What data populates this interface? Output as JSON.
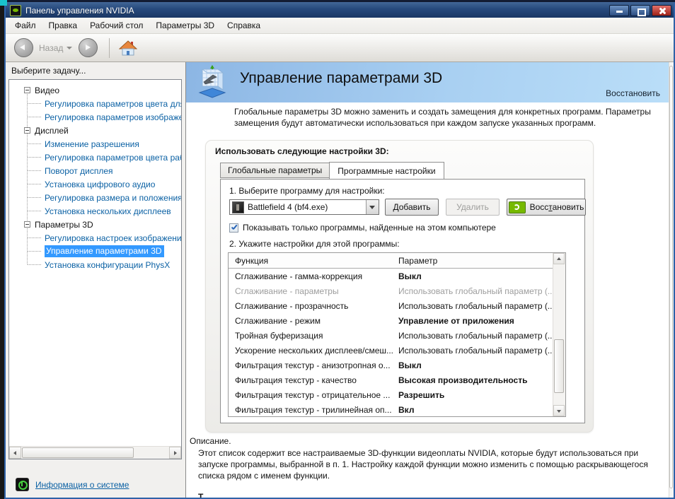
{
  "window": {
    "title": "Панель управления NVIDIA"
  },
  "menu": {
    "items": [
      "Файл",
      "Правка",
      "Рабочий стол",
      "Параметры 3D",
      "Справка"
    ]
  },
  "toolbar": {
    "back_label": "Назад"
  },
  "sidebar": {
    "header": "Выберите задачу...",
    "selected": "Управление параметрами 3D",
    "sections": [
      {
        "label": "Видео",
        "children": [
          "Регулировка параметров цвета для ви",
          "Регулировка параметров изображени"
        ]
      },
      {
        "label": "Дисплей",
        "children": [
          "Изменение разрешения",
          "Регулировка параметров цвета рабоч",
          "Поворот дисплея",
          "Установка цифрового аудио",
          "Регулировка размера и положения ра",
          "Установка нескольких дисплеев"
        ]
      },
      {
        "label": "Параметры 3D",
        "children": [
          "Регулировка настроек изображения с",
          "Управление параметрами 3D",
          "Установка конфигурации PhysX"
        ]
      }
    ],
    "footer_link": "Информация о системе"
  },
  "content": {
    "title": "Управление параметрами 3D",
    "restore_link": "Восстановить",
    "intro": "Глобальные параметры 3D можно заменить и создать замещения для конкретных программ. Параметры замещения будут автоматически использоваться при каждом запуске указанных программ.",
    "panel_label": "Использовать следующие настройки 3D:",
    "tabs": [
      "Глобальные параметры",
      "Программные настройки"
    ],
    "active_tab": "Программные настройки",
    "step1_label": "1. Выберите программу для настройки:",
    "program": "Battlefield 4 (bf4.exe)",
    "buttons": {
      "add": "Добавить",
      "remove": "Удалить",
      "restore_pre": "Восс",
      "restore_key": "т",
      "restore_post": "ановить"
    },
    "checkbox_label": "Показывать только программы, найденные на этом компьютере",
    "step2_label": "2. Укажите настройки для этой программы:",
    "table": {
      "headers": [
        "Функция",
        "Параметр"
      ],
      "rows": [
        {
          "feature": "Сглаживание - гамма-коррекция",
          "value": "Выкл",
          "style": "bold"
        },
        {
          "feature": "Сглаживание - параметры",
          "value": "Использовать глобальный параметр (...",
          "style": "disabled"
        },
        {
          "feature": "Сглаживание - прозрачность",
          "value": "Использовать глобальный параметр (...",
          "style": "normal"
        },
        {
          "feature": "Сглаживание - режим",
          "value": "Управление от приложения",
          "style": "bold"
        },
        {
          "feature": "Тройная буферизация",
          "value": "Использовать глобальный параметр (...",
          "style": "normal"
        },
        {
          "feature": "Ускорение нескольких дисплеев/смеш...",
          "value": "Использовать глобальный параметр (...",
          "style": "normal"
        },
        {
          "feature": "Фильтрация текстур - анизотропная о...",
          "value": "Выкл",
          "style": "bold"
        },
        {
          "feature": "Фильтрация текстур - качество",
          "value": "Высокая производительность",
          "style": "bold"
        },
        {
          "feature": "Фильтрация текстур - отрицательное ...",
          "value": "Разрешить",
          "style": "bold"
        },
        {
          "feature": "Фильтрация текстур - трилинейная оп...",
          "value": "Вкл",
          "style": "bold"
        }
      ]
    },
    "description_title": "Описание.",
    "description": "Этот список содержит все настраиваемые 3D-функции видеоплаты NVIDIA, которые будут использоваться при запуске программы, выбранной в п. 1. Настройку каждой функции можно изменить с помощью раскрывающегося списка рядом с именем функции.",
    "partial_text": "Т"
  },
  "colors": {
    "accent_blue": "#3399ff",
    "nvidia_green": "#76b900",
    "banner_blue": "#a9d0f2",
    "link_blue": "#0b61a4"
  }
}
